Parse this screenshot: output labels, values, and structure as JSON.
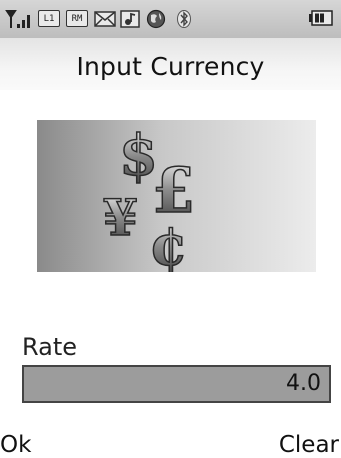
{
  "status_bar": {
    "line_indicator": "L1",
    "roaming_indicator": "RM",
    "icons": [
      "signal-icon",
      "line-l1-icon",
      "roaming-icon",
      "message-icon",
      "music-icon",
      "internet-icon",
      "bluetooth-icon",
      "battery-icon"
    ]
  },
  "screen": {
    "title": "Input Currency"
  },
  "form": {
    "rate_label": "Rate",
    "rate_value": "4.0"
  },
  "softkeys": {
    "left": "Ok",
    "right": "Clear"
  }
}
